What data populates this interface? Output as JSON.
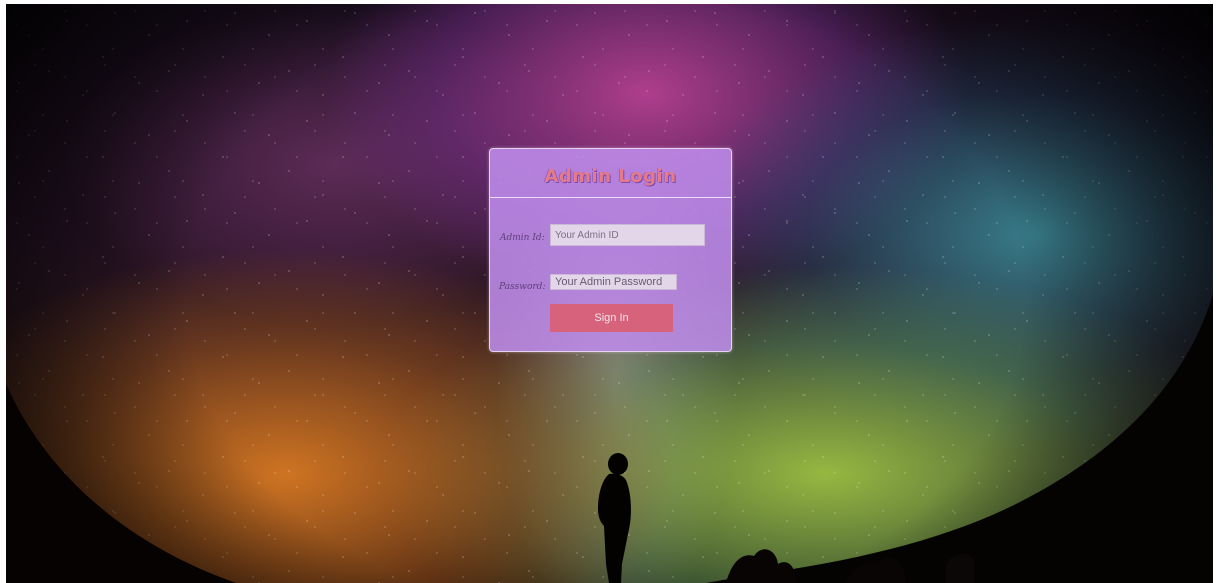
{
  "login": {
    "title": "Admin Login",
    "admin_id_label": "Admin Id:",
    "admin_id_placeholder": "Your Admin ID",
    "password_label": "Password:",
    "password_placeholder": "Your Admin Password",
    "submit_label": "Sign In"
  },
  "colors": {
    "card_background": "#be8ceb",
    "title_text": "#e47a8a",
    "button_background": "#d7627c",
    "input_background": "#e3d6e8"
  }
}
